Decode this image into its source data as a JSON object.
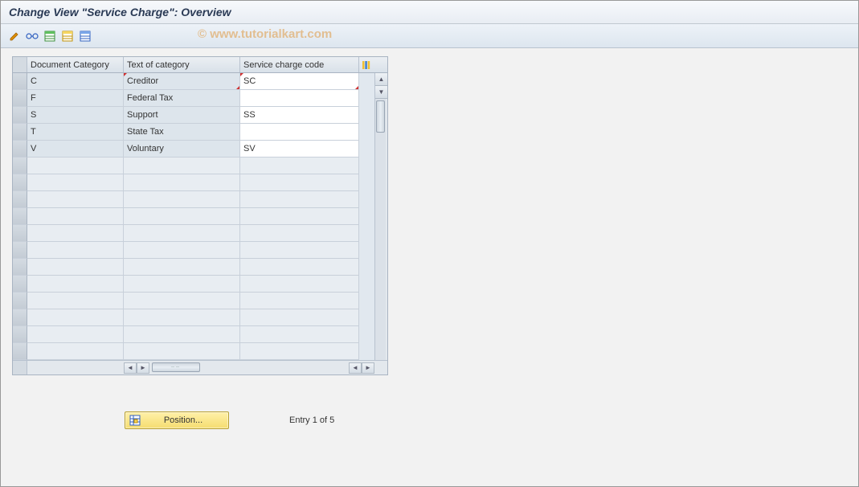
{
  "title": "Change View \"Service Charge\": Overview",
  "watermark": "© www.tutorialkart.com",
  "toolbar": {
    "icons": [
      {
        "name": "change-icon"
      },
      {
        "name": "display-icon"
      },
      {
        "name": "new-entries-icon"
      },
      {
        "name": "copy-as-icon"
      },
      {
        "name": "delete-icon"
      }
    ]
  },
  "grid": {
    "columns": [
      {
        "label": "Document Category"
      },
      {
        "label": "Text of category"
      },
      {
        "label": "Service charge code"
      }
    ],
    "rows": [
      {
        "doc_cat": "C",
        "text": "Creditor",
        "code": "SC"
      },
      {
        "doc_cat": "F",
        "text": "Federal Tax",
        "code": ""
      },
      {
        "doc_cat": "S",
        "text": "Support",
        "code": "SS"
      },
      {
        "doc_cat": "T",
        "text": "State Tax",
        "code": ""
      },
      {
        "doc_cat": "V",
        "text": "Voluntary",
        "code": "SV"
      }
    ],
    "empty_rows": 12
  },
  "footer": {
    "position_label": "Position...",
    "entry_text": "Entry 1 of 5"
  }
}
